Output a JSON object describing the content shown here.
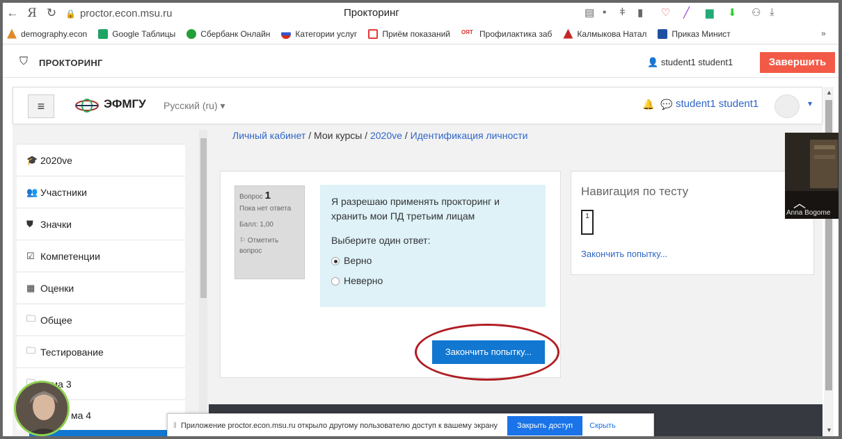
{
  "browser": {
    "url": "proctor.econ.msu.ru",
    "tab_title": "Прокторинг",
    "bookmarks": [
      {
        "label": "demography.econ",
        "color": "#e08a2e"
      },
      {
        "label": "Google Таблицы",
        "color": "#1fa463"
      },
      {
        "label": "Сбербанк Онлайн",
        "color": "#21a038"
      },
      {
        "label": "Категории услуг",
        "color": "#3355cc"
      },
      {
        "label": "Приём показаний",
        "color": "#e53935"
      },
      {
        "label": "Профилактика заб",
        "color": "#d32f2f"
      },
      {
        "label": "Калмыкова Натал",
        "color": "#c62828"
      },
      {
        "label": "Приказ Минист",
        "color": "#1e4fa3"
      }
    ],
    "more": "»"
  },
  "proctor": {
    "title": "ПРОКТОРИНГ",
    "user": "student1 student1",
    "finish": "Завершить"
  },
  "header": {
    "brand": "ЭФМГУ",
    "language": "Русский (ru)",
    "user": "student1 student1"
  },
  "breadcrumb": [
    "Личный кабинет",
    "Мои курсы",
    "2020ve",
    "Идентификация личности"
  ],
  "sidebar": [
    {
      "label": "2020ve",
      "icon": "graduation-cap-icon"
    },
    {
      "label": "Участники",
      "icon": "users-icon"
    },
    {
      "label": "Значки",
      "icon": "shield-icon"
    },
    {
      "label": "Компетенции",
      "icon": "checkbox-icon"
    },
    {
      "label": "Оценки",
      "icon": "table-icon"
    },
    {
      "label": "Общее",
      "icon": "folder-icon"
    },
    {
      "label": "Тестирование",
      "icon": "folder-icon"
    },
    {
      "label": "Тема 3",
      "icon": "folder-icon"
    },
    {
      "label": "ма 4",
      "icon": "folder-icon"
    }
  ],
  "question": {
    "label": "Вопрос",
    "number": "1",
    "status": "Пока нет ответа",
    "score": "Балл: 1,00",
    "flag": "Отметить вопрос",
    "text": "Я разрешаю применять прокторинг и хранить  мои ПД третьим лицам",
    "prompt": "Выберите один ответ:",
    "options": [
      {
        "label": "Верно",
        "selected": true
      },
      {
        "label": "Неверно",
        "selected": false
      }
    ],
    "finish_button": "Закончить попытку..."
  },
  "navigation": {
    "title": "Навигация по тесту",
    "box": "1",
    "finish_link": "Закончить попытку..."
  },
  "notice": {
    "text": "Приложение proctor.econ.msu.ru открыло другому пользователю доступ к вашему экрану",
    "stop": "Закрыть доступ",
    "hide": "Скрыть"
  },
  "webcam": {
    "name": "Anna Bogome"
  }
}
